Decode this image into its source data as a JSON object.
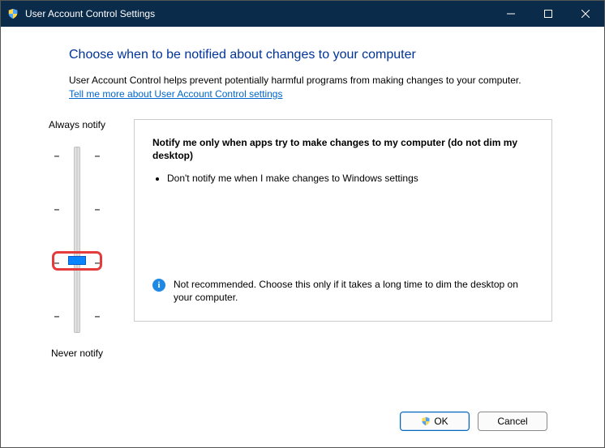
{
  "window": {
    "title": "User Account Control Settings"
  },
  "main": {
    "heading": "Choose when to be notified about changes to your computer",
    "intro": "User Account Control helps prevent potentially harmful programs from making changes to your computer.",
    "link": "Tell me more about User Account Control settings"
  },
  "slider": {
    "top_label": "Always notify",
    "bottom_label": "Never notify"
  },
  "panel": {
    "title": "Notify me only when apps try to make changes to my computer (do not dim my desktop)",
    "bullet1": "Don't notify me when I make changes to Windows settings",
    "note": "Not recommended. Choose this only if it takes a long time to dim the desktop on your computer."
  },
  "buttons": {
    "ok": "OK",
    "cancel": "Cancel"
  }
}
